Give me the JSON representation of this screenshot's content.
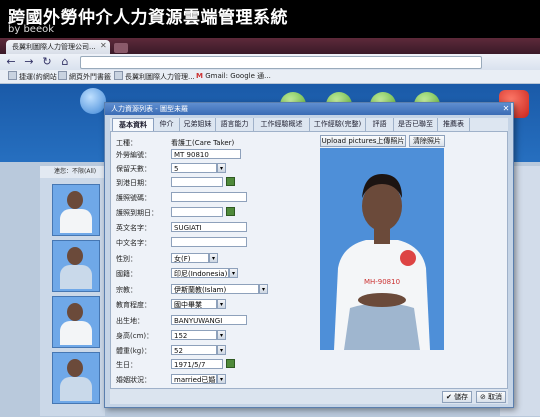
{
  "video": {
    "title": "跨國外勞仲介人力資源雲端管理系統",
    "byline": "by beeok"
  },
  "browser": {
    "tab_title": "長翼利圖際人力管理公司...",
    "bookmarks": [
      "捷運(約網站",
      "網頁外鬥書籤",
      "長翼利圖際人力管理...",
      "Gmail: Google 通..."
    ]
  },
  "app": {
    "left_panel_header": "連您：不限(All)",
    "dialog_title": "人力資源列表 - 圖型未羅",
    "tabs": [
      "基本資料",
      "仲介",
      "兄弟姐妹",
      "語言能力",
      "工作經驗概述",
      "工作經驗(完整)",
      "評語",
      "是否已聯至",
      "推薦表"
    ],
    "active_tab": "基本資料",
    "form": {
      "job_type_label": "工種：",
      "job_type": "看護工(Care Taker)",
      "worker_no_label": "外勞編號：",
      "worker_no": "MT 90810",
      "hold_days_label": "保留天數：",
      "hold_days": "5",
      "arrival_date_label": "到港日期：",
      "arrival_date": "",
      "passport_no_label": "護照號碼：",
      "passport_no": "",
      "passport_expiry_label": "護照到期日：",
      "passport_expiry": "",
      "english_name_label": "英文名字：",
      "english_name": "SUGIATI",
      "chinese_name_label": "中文名字：",
      "chinese_name": "",
      "gender_label": "性別：",
      "gender": "女(F)",
      "nationality_label": "國籍：",
      "nationality": "印尼(Indonesia)",
      "religion_label": "宗教：",
      "religion": "伊斯蘭教(Islam)",
      "education_label": "教育程度：",
      "education": "國中畢業",
      "birthplace_label": "出生地：",
      "birthplace": "BANYUWANGI",
      "height_label": "身高(cm)：",
      "height": "152",
      "weight_label": "體重(kg)：",
      "weight": "52",
      "birthday_label": "生日：",
      "birthday": "1971/5/7",
      "marital_label": "婚姻狀況：",
      "marital": "married已婚"
    },
    "photo_buttons": {
      "upload": "Upload pictures上傳照片",
      "delete": "清除照片"
    },
    "footer": {
      "save": "儲存",
      "cancel": "取消"
    }
  }
}
